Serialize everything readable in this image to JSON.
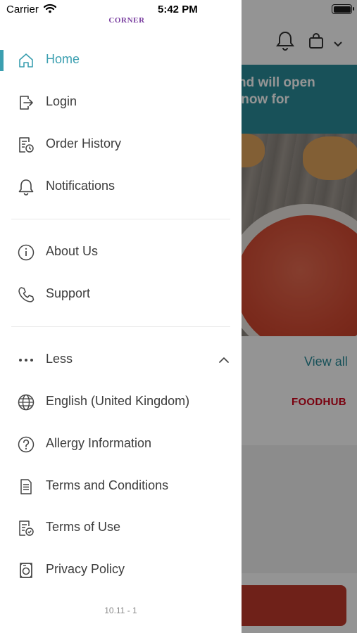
{
  "status_bar": {
    "carrier": "Carrier",
    "time": "5:42 PM"
  },
  "drawer": {
    "logo_text": "CORNER",
    "primary_items": [
      {
        "label": "Home",
        "icon": "home-icon",
        "active": true
      },
      {
        "label": "Login",
        "icon": "login-icon",
        "active": false
      },
      {
        "label": "Order History",
        "icon": "order-history-icon",
        "active": false
      },
      {
        "label": "Notifications",
        "icon": "bell-icon",
        "active": false
      }
    ],
    "secondary_items": [
      {
        "label": "About Us",
        "icon": "info-icon"
      },
      {
        "label": "Support",
        "icon": "phone-icon"
      }
    ],
    "less_toggle": {
      "label": "Less",
      "icon": "more-dots-icon",
      "chevron": "chevron-up-icon"
    },
    "more_items": [
      {
        "label": "English (United Kingdom)",
        "icon": "globe-icon"
      },
      {
        "label": "Allergy Information",
        "icon": "question-icon"
      },
      {
        "label": "Terms and Conditions",
        "icon": "document-icon"
      },
      {
        "label": "Terms of Use",
        "icon": "document-check-icon"
      },
      {
        "label": "Privacy Policy",
        "icon": "privacy-icon"
      }
    ],
    "version": "10.11 - 1"
  },
  "background": {
    "banner_text": "ed and will open\nrder now for",
    "view_all": "View all",
    "brand": "FOODHUB"
  },
  "colors": {
    "accent": "#3b9fb0",
    "text": "#3c3c3c",
    "logo": "#7a3fa0",
    "banner": "#2a8c99",
    "brand": "#d0021b",
    "overlay": "rgba(0,0,0,0.42)"
  }
}
